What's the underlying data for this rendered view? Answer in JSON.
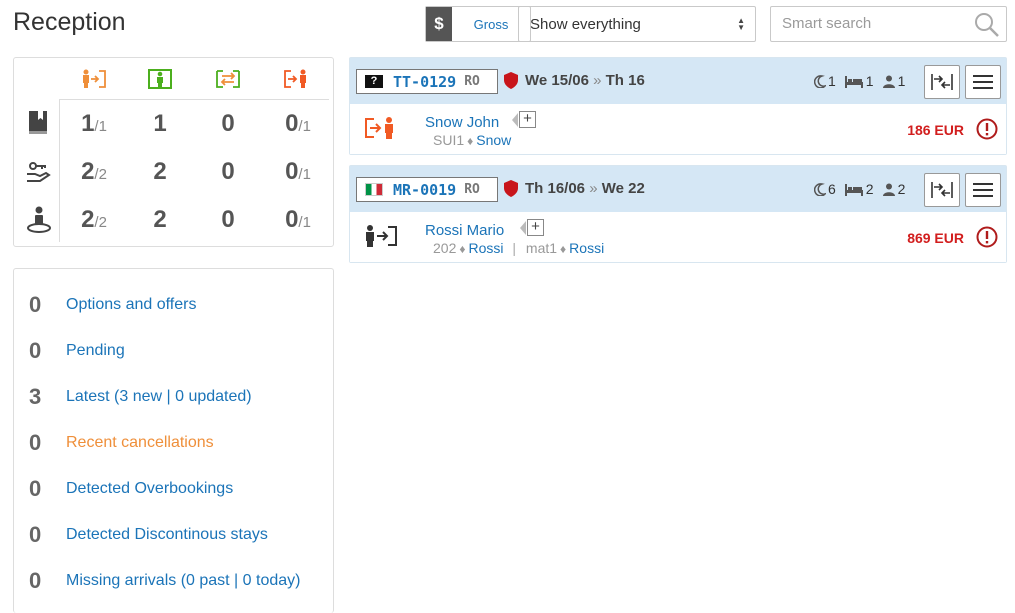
{
  "header": {
    "title": "Reception",
    "currency_symbol": "$",
    "currency_mode": "Gross",
    "filter_selected": "Show everything",
    "search_placeholder": "Smart search"
  },
  "stats": {
    "columns": [
      {
        "icon": "arrival-icon",
        "color": "#ef8f3a"
      },
      {
        "icon": "in-house-icon",
        "color": "#4caf1e"
      },
      {
        "icon": "room-move-icon",
        "color": "#ef8f3a"
      },
      {
        "icon": "departure-icon",
        "color": "#f15a24"
      }
    ],
    "rows": [
      {
        "icon": "booking-book-icon",
        "cells": [
          {
            "big": "1",
            "small": "/1"
          },
          {
            "big": "1",
            "small": ""
          },
          {
            "big": "0",
            "small": ""
          },
          {
            "big": "0",
            "small": "/1"
          }
        ]
      },
      {
        "icon": "hand-key-icon",
        "cells": [
          {
            "big": "2",
            "small": "/2"
          },
          {
            "big": "2",
            "small": ""
          },
          {
            "big": "0",
            "small": ""
          },
          {
            "big": "0",
            "small": "/1"
          }
        ]
      },
      {
        "icon": "guest-person-icon",
        "cells": [
          {
            "big": "2",
            "small": "/2"
          },
          {
            "big": "2",
            "small": ""
          },
          {
            "big": "0",
            "small": ""
          },
          {
            "big": "0",
            "small": "/1"
          }
        ]
      }
    ]
  },
  "links": [
    {
      "count": "0",
      "label": "Options and offers",
      "color": "#1b74b8"
    },
    {
      "count": "0",
      "label": "Pending",
      "color": "#1b74b8"
    },
    {
      "count": "3",
      "label": "Latest (3 new | 0 updated)",
      "color": "#1b74b8"
    },
    {
      "count": "0",
      "label": "Recent cancellations",
      "color": "#ef8f3a"
    },
    {
      "count": "0",
      "label": "Detected Overbookings",
      "color": "#1b74b8"
    },
    {
      "count": "0",
      "label": "Detected Discontinous stays",
      "color": "#1b74b8"
    },
    {
      "count": "0",
      "label": "Missing arrivals (0 past | 0 today)",
      "color": "#1b74b8"
    }
  ],
  "bookings": [
    {
      "flag": "unknown",
      "code": "TT-0129",
      "suffix": "RO",
      "date_from": "We 15/06",
      "date_sep": "»",
      "date_to": "Th 16",
      "nights": "1",
      "rooms": "1",
      "guests": "1",
      "guest_icon": "departure-icon",
      "guest_name": "Snow John",
      "rooms_detail": [
        {
          "room": "SUI1",
          "name": "Snow"
        }
      ],
      "price": "186 EUR"
    },
    {
      "flag": "italy",
      "code": "MR-0019",
      "suffix": "RO",
      "date_from": "Th 16/06",
      "date_sep": "»",
      "date_to": "We 22",
      "nights": "6",
      "rooms": "2",
      "guests": "2",
      "guest_icon": "arrival-icon",
      "guest_name": "Rossi Mario",
      "rooms_detail": [
        {
          "room": "202",
          "name": "Rossi"
        },
        {
          "room": "mat1",
          "name": "Rossi"
        }
      ],
      "price": "869 EUR"
    }
  ]
}
